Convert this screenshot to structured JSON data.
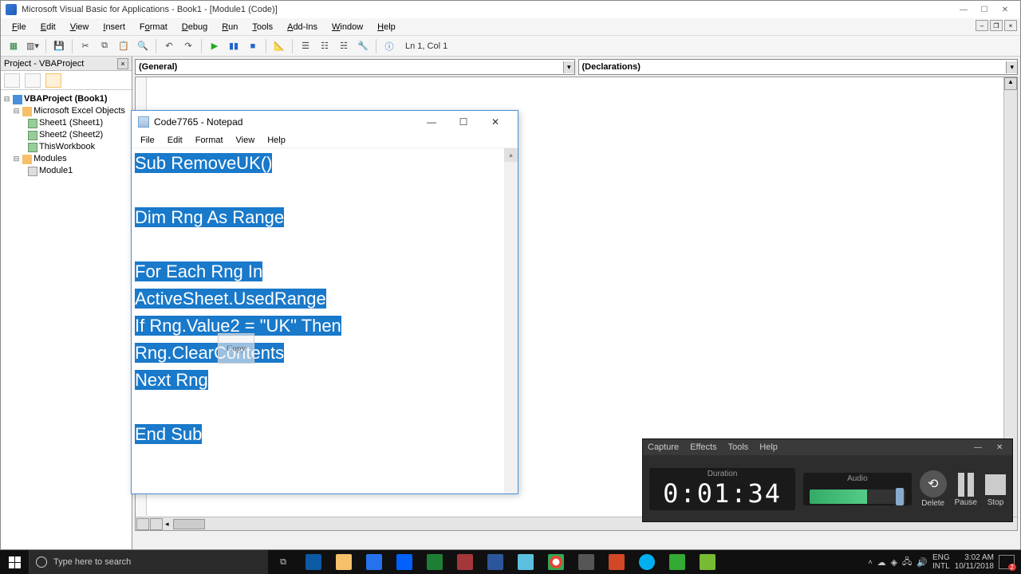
{
  "vba": {
    "title": "Microsoft Visual Basic for Applications - Book1 - [Module1 (Code)]",
    "menu": [
      "File",
      "Edit",
      "View",
      "Insert",
      "Format",
      "Debug",
      "Run",
      "Tools",
      "Add-Ins",
      "Window",
      "Help"
    ],
    "cursor_status": "Ln 1, Col 1",
    "dropdown_left": "(General)",
    "dropdown_right": "(Declarations)",
    "project": {
      "pane_title": "Project - VBAProject",
      "root": "VBAProject (Book1)",
      "groups": [
        {
          "label": "Microsoft Excel Objects",
          "items": [
            "Sheet1 (Sheet1)",
            "Sheet2 (Sheet2)",
            "ThisWorkbook"
          ]
        },
        {
          "label": "Modules",
          "items": [
            "Module1"
          ]
        }
      ]
    }
  },
  "notepad": {
    "title": "Code7765 - Notepad",
    "menu": [
      "File",
      "Edit",
      "Format",
      "View",
      "Help"
    ],
    "code_lines": [
      "Sub RemoveUK()",
      "",
      "Dim Rng As Range",
      "",
      "For Each Rng In ",
      "ActiveSheet.UsedRange",
      "  If Rng.Value2 = \"UK\" Then ",
      "Rng.ClearContents",
      "Next Rng",
      "",
      "End Sub"
    ],
    "tooltip": "Copy"
  },
  "camtasia": {
    "menu": [
      "Capture",
      "Effects",
      "Tools",
      "Help"
    ],
    "duration_label": "Duration",
    "duration_value": "0:01:34",
    "audio_label": "Audio",
    "buttons": {
      "delete": "Delete",
      "pause": "Pause",
      "stop": "Stop"
    }
  },
  "taskbar": {
    "search_placeholder": "Type here to search",
    "lang": "ENG",
    "kbd": "INTL",
    "time": "3:02 AM",
    "date": "10/11/2018",
    "notif_count": "2"
  }
}
